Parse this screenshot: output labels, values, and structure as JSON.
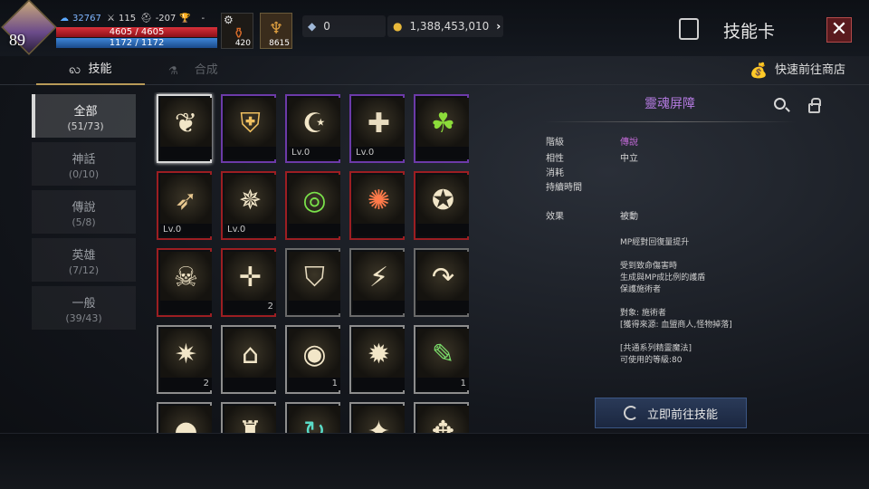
{
  "player": {
    "level": "89",
    "power": "32767",
    "stat_a": "115",
    "stat_b": "-207",
    "stat_c": "-",
    "hp": "4605 / 4605",
    "mp": "1172 / 1172"
  },
  "consumables": [
    {
      "icon": "potion-icon",
      "count": "420"
    },
    {
      "icon": "horn-icon",
      "count": "8615"
    }
  ],
  "currency": {
    "gems": "0",
    "gold": "1,388,453,010"
  },
  "header": {
    "title": "技能卡"
  },
  "tabs": [
    {
      "label": "技能",
      "active": true
    },
    {
      "label": "合成",
      "active": false
    }
  ],
  "shop_link": "快速前往商店",
  "categories": [
    {
      "name": "全部",
      "count": "(51/73)",
      "active": true
    },
    {
      "name": "神話",
      "count": "(0/10)"
    },
    {
      "name": "傳說",
      "count": "(5/8)"
    },
    {
      "name": "英雄",
      "count": "(7/12)"
    },
    {
      "name": "一般",
      "count": "(39/43)"
    }
  ],
  "cards": [
    {
      "icon": "wings-icon",
      "glyph": "❦",
      "border": "sel",
      "level": "",
      "count": ""
    },
    {
      "icon": "shield-elements-icon",
      "glyph": "⛨",
      "border": "purple",
      "level": "",
      "count": ""
    },
    {
      "icon": "moon-star-icon",
      "glyph": "☪",
      "border": "purple",
      "level": "Lv.0",
      "count": ""
    },
    {
      "icon": "holy-shield-icon",
      "glyph": "✚",
      "border": "purple",
      "level": "Lv.0",
      "count": ""
    },
    {
      "icon": "green-claw-icon",
      "glyph": "☘",
      "border": "purple",
      "level": "",
      "count": ""
    },
    {
      "icon": "bow-shield-icon",
      "glyph": "➶",
      "border": "red",
      "level": "Lv.0",
      "count": ""
    },
    {
      "icon": "arrow-burst-icon",
      "glyph": "✵",
      "border": "red",
      "level": "Lv.0",
      "count": ""
    },
    {
      "icon": "green-beacon-icon",
      "glyph": "◎",
      "border": "red",
      "level": "",
      "count": ""
    },
    {
      "icon": "fire-claw-icon",
      "glyph": "✺",
      "border": "red",
      "level": "",
      "count": ""
    },
    {
      "icon": "star-lock-icon",
      "glyph": "✪",
      "border": "red",
      "level": "",
      "count": ""
    },
    {
      "icon": "skull-target-icon",
      "glyph": "☠",
      "border": "red",
      "level": "",
      "count": ""
    },
    {
      "icon": "heal-plus-icon",
      "glyph": "✛",
      "border": "red",
      "level": "",
      "count": "2"
    },
    {
      "icon": "crest-shield-icon",
      "glyph": "⛉",
      "border": "gray",
      "level": "",
      "count": ""
    },
    {
      "icon": "lightning-icon",
      "glyph": "⚡",
      "border": "gray",
      "level": "",
      "count": ""
    },
    {
      "icon": "curved-arrow-icon",
      "glyph": "↷",
      "border": "gray",
      "level": "",
      "count": ""
    },
    {
      "icon": "light-burst-icon",
      "glyph": "✷",
      "border": "white",
      "level": "",
      "count": "2"
    },
    {
      "icon": "altar-icon",
      "glyph": "⌂",
      "border": "white",
      "level": "",
      "count": ""
    },
    {
      "icon": "evil-eye-icon",
      "glyph": "◉",
      "border": "white",
      "level": "",
      "count": "1"
    },
    {
      "icon": "spiked-wheel-icon",
      "glyph": "✹",
      "border": "white",
      "level": "",
      "count": ""
    },
    {
      "icon": "green-feather-icon",
      "glyph": "✎",
      "border": "white",
      "level": "",
      "count": "1"
    },
    {
      "icon": "orb-icon",
      "glyph": "●",
      "border": "white",
      "level": "",
      "count": ""
    },
    {
      "icon": "idol-icon",
      "glyph": "♜",
      "border": "white",
      "level": "",
      "count": ""
    },
    {
      "icon": "green-swirl-icon",
      "glyph": "↻",
      "border": "white",
      "level": "",
      "count": ""
    },
    {
      "icon": "sparkle-icon",
      "glyph": "✦",
      "border": "white",
      "level": "",
      "count": ""
    },
    {
      "icon": "rune-icon",
      "glyph": "✥",
      "border": "white",
      "level": "",
      "count": ""
    }
  ],
  "detail": {
    "name": "靈魂屏障",
    "name_color": "#b47ae0",
    "fields": [
      {
        "k": "階級",
        "v": "傳說",
        "v_color": "#c36ad8"
      },
      {
        "k": "相性",
        "v": "中立",
        "v_color": "#d6d6d6"
      },
      {
        "k": "消耗",
        "v": "",
        "v_color": "#d6d6d6"
      },
      {
        "k": "持續時間",
        "v": "",
        "v_color": "#d6d6d6"
      }
    ],
    "effect_label": "效果",
    "effect_type": "被動",
    "description": [
      "MP經對回復量提升",
      "",
      "受到致命傷害時",
      "生成與MP成比例的護盾",
      "保護施術者",
      "",
      "對象: 施術者",
      "[獲得來源: 血盟商人,怪物掉落]",
      "",
      "[共通系列精靈魔法]",
      "可使用的等級:80"
    ],
    "goto_button": "立即前往技能"
  }
}
